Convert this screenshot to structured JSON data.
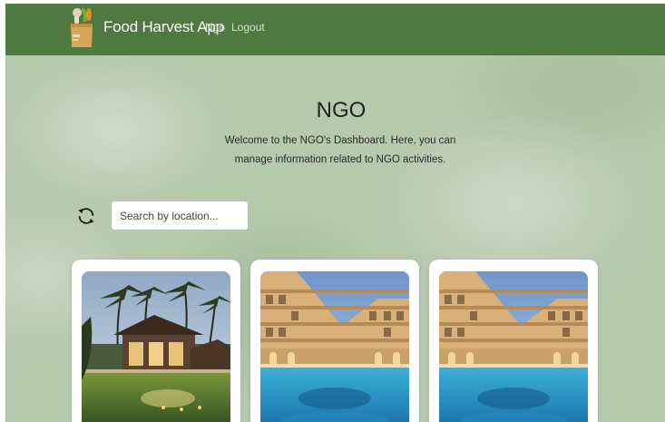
{
  "header": {
    "app_title": "Food Harvest App",
    "nav": [
      {
        "label": "Ngo"
      },
      {
        "label": "Logout"
      }
    ],
    "logo_icon": "grocery-bag-icon"
  },
  "main": {
    "heading": "NGO",
    "welcome": "Welcome to the NGO's Dashboard. Here, you can manage information related to NGO activities.",
    "search": {
      "placeholder": "Search by location...",
      "value": ""
    },
    "refresh_icon": "refresh-icon"
  },
  "cards": [
    {
      "image": "tropical-villa-pool-photo"
    },
    {
      "image": "hotel-pool-photo"
    },
    {
      "image": "hotel-pool-photo"
    }
  ],
  "colors": {
    "navbar": "#4e7a40",
    "background": "#b5c9ad",
    "card": "#ffffff"
  }
}
